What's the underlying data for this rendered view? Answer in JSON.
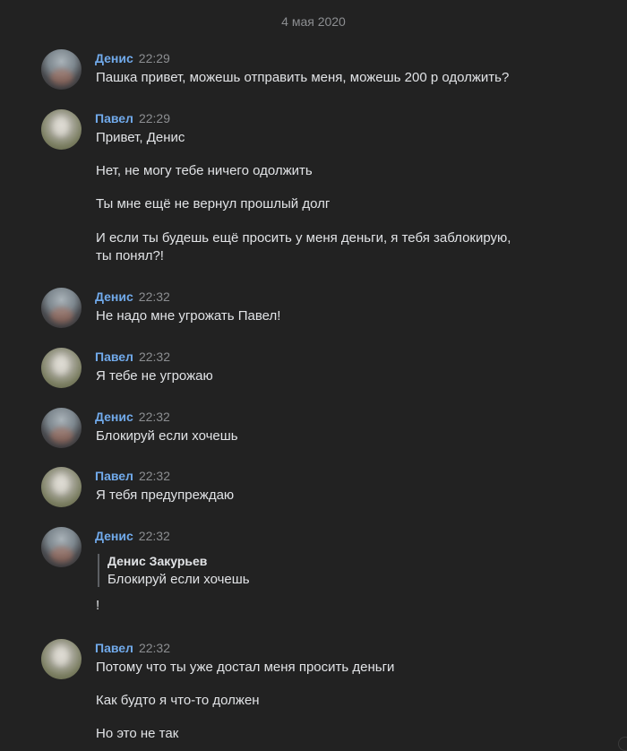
{
  "date_separator": "4 мая 2020",
  "messages": [
    {
      "author": "Денис",
      "time": "22:29",
      "lines": [
        "Пашка привет, можешь отправить меня, можешь 200 р одолжить?"
      ]
    },
    {
      "author": "Павел",
      "time": "22:29",
      "lines": [
        "Привет, Денис",
        "Нет, не могу тебе ничего одолжить",
        "Ты мне ещё не вернул прошлый долг",
        "И если ты будешь ещё просить у меня деньги, я тебя заблокирую,",
        "ты понял?!"
      ]
    },
    {
      "author": "Денис",
      "time": "22:32",
      "lines": [
        "Не надо мне угрожать Павел!"
      ]
    },
    {
      "author": "Павел",
      "time": "22:32",
      "lines": [
        "Я тебе не угрожаю"
      ]
    },
    {
      "author": "Денис",
      "time": "22:32",
      "lines": [
        "Блокируй если хочешь"
      ]
    },
    {
      "author": "Павел",
      "time": "22:32",
      "lines": [
        "Я тебя предупреждаю"
      ]
    },
    {
      "author": "Денис",
      "time": "22:32",
      "quote": {
        "author": "Денис Закурьев",
        "text": "Блокируй если хочешь"
      },
      "lines": [
        "!"
      ]
    },
    {
      "author": "Павел",
      "time": "22:32",
      "lines": [
        "Потому что ты уже достал меня просить деньги",
        "Как будто я что-то должен",
        "Но это не так"
      ]
    }
  ],
  "avatar_icons": {
    "denis": "user-avatar-denis",
    "pavel": "user-avatar-pavel"
  },
  "colors": {
    "background": "#222222",
    "author": "#71aaeb",
    "text": "#e1e3e6",
    "muted": "#8c8e91"
  }
}
